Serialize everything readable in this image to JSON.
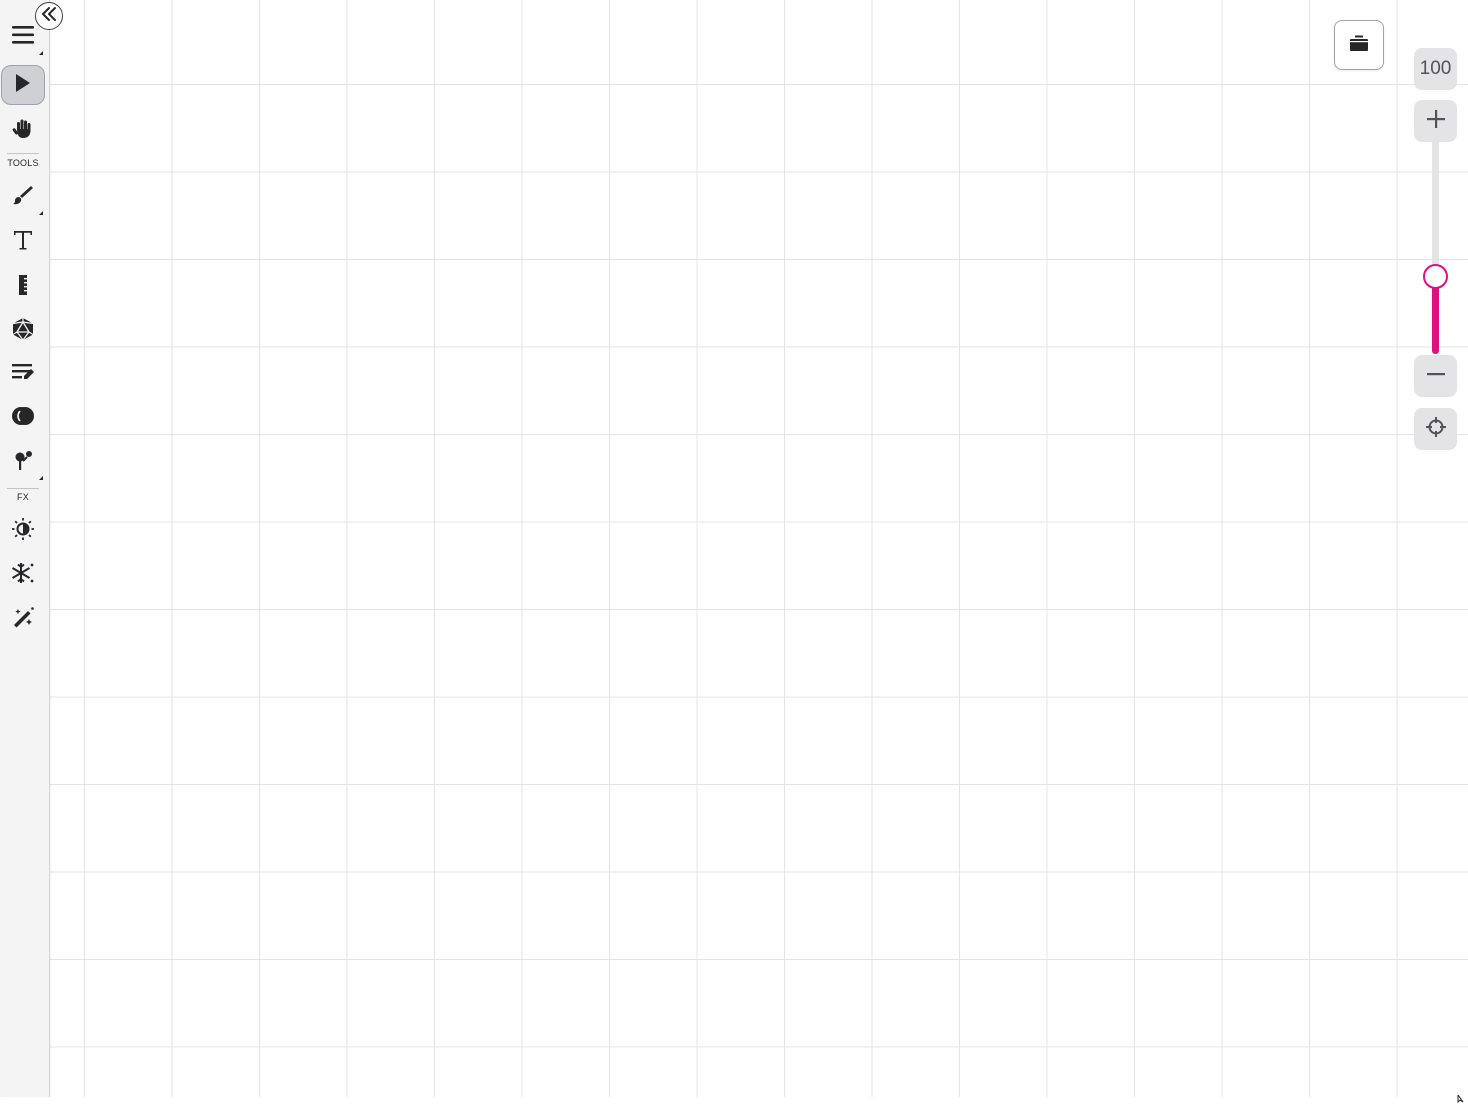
{
  "sidebar": {
    "sections": {
      "tools_label": "TOOLS",
      "fx_label": "FX"
    },
    "items": [
      {
        "name": "menu",
        "icon": "hamburger-menu-icon",
        "active": false
      },
      {
        "name": "select",
        "icon": "cursor-arrow-icon",
        "active": true
      },
      {
        "name": "pan",
        "icon": "hand-icon",
        "active": false
      },
      {
        "name": "brush",
        "icon": "paintbrush-icon",
        "active": false
      },
      {
        "name": "text",
        "icon": "text-icon",
        "active": false
      },
      {
        "name": "ruler",
        "icon": "ruler-icon",
        "active": false
      },
      {
        "name": "dice",
        "icon": "dice-icon",
        "active": false
      },
      {
        "name": "notes",
        "icon": "notes-icon",
        "active": false
      },
      {
        "name": "fog",
        "icon": "fog-icon",
        "active": false
      },
      {
        "name": "pin",
        "icon": "pin-icon",
        "active": false
      },
      {
        "name": "light",
        "icon": "light-icon",
        "active": false
      },
      {
        "name": "weather",
        "icon": "snowflake-icon",
        "active": false
      },
      {
        "name": "magic",
        "icon": "magic-wand-icon",
        "active": false
      }
    ]
  },
  "zoom": {
    "value": "100",
    "level_fraction": 0.37
  },
  "colors": {
    "accent": "#e0107f",
    "grid": "#e4e4e7",
    "sidebar_bg": "#f4f4f5"
  }
}
